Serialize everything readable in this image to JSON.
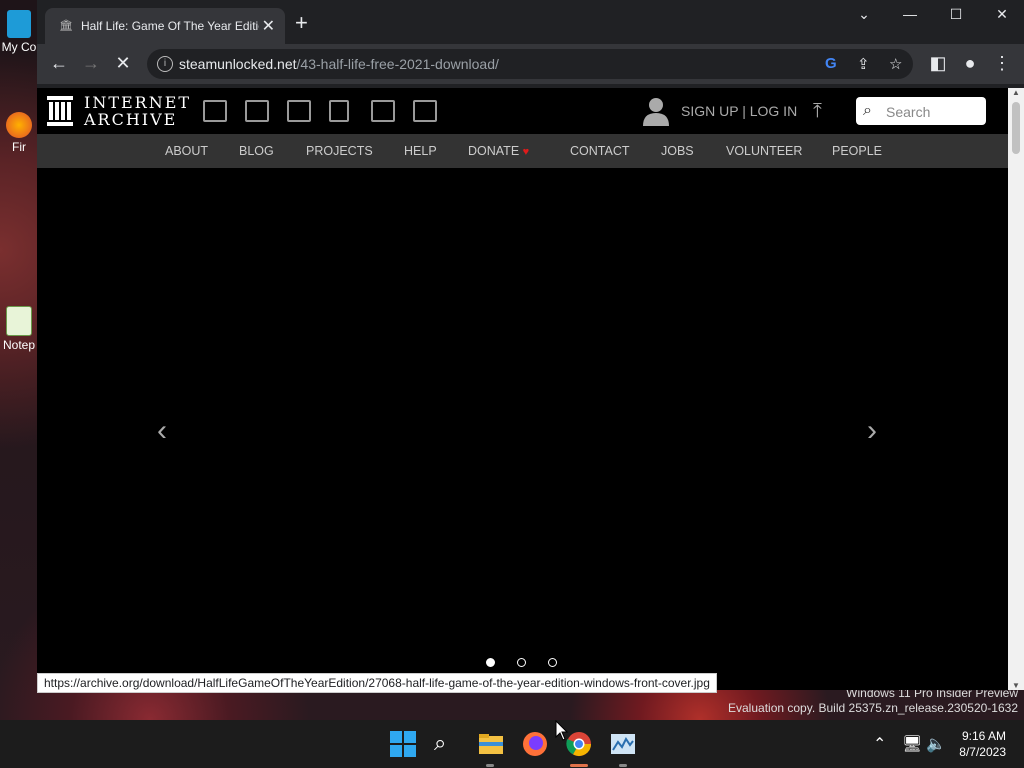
{
  "desktop": {
    "icons": [
      {
        "label": "My Co"
      },
      {
        "label": "Fir"
      },
      {
        "label": "Notep"
      }
    ],
    "watermark_line1": "Windows 11 Pro Insider Preview",
    "watermark_line2": "Evaluation copy. Build 25375.zn_release.230520-1632"
  },
  "browser": {
    "tab_title": "Half Life: Game Of The Year Editio",
    "url_domain": "steamunlocked.net",
    "url_path": "/43-half-life-free-2021-download/",
    "status_url": "https://archive.org/download/HalfLifeGameOfTheYearEdition/27068-half-life-game-of-the-year-edition-windows-front-cover.jpg"
  },
  "ia": {
    "logo_line1": "INTERNET",
    "logo_line2": "ARCHIVE",
    "signup": "SIGN UP | LOG IN",
    "search_placeholder": "Search",
    "nav": [
      "ABOUT",
      "BLOG",
      "PROJECTS",
      "HELP",
      "DONATE",
      "CONTACT",
      "JOBS",
      "VOLUNTEER",
      "PEOPLE"
    ],
    "carousel_active_index": 0,
    "carousel_count": 3
  },
  "taskbar": {
    "time": "9:16 AM",
    "date": "8/7/2023"
  },
  "colors": {
    "page_bg": "#000000",
    "nav_bg": "#333333",
    "heart": "#e01b1b"
  }
}
